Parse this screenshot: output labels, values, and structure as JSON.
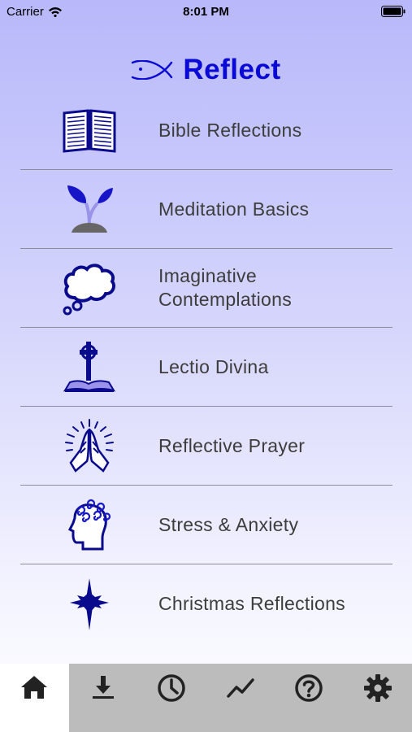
{
  "status_bar": {
    "carrier": "Carrier",
    "time": "8:01 PM"
  },
  "header": {
    "title": "Reflect",
    "logo_icon": "ichthys-fish-icon",
    "accent_color": "#0a0ad6"
  },
  "menu": {
    "items": [
      {
        "label": "Bible Reflections",
        "icon": "open-bible-icon"
      },
      {
        "label": "Meditation Basics",
        "icon": "sprout-icon"
      },
      {
        "label": "Imaginative\nContemplations",
        "icon": "thought-bubble-icon"
      },
      {
        "label": "Lectio Divina",
        "icon": "cross-on-book-icon"
      },
      {
        "label": "Reflective Prayer",
        "icon": "praying-hands-icon"
      },
      {
        "label": "Stress & Anxiety",
        "icon": "head-spirals-icon"
      },
      {
        "label": "Christmas Reflections",
        "icon": "star-icon"
      }
    ]
  },
  "tab_bar": {
    "tabs": [
      {
        "icon": "home-icon",
        "active": true
      },
      {
        "icon": "download-icon",
        "active": false
      },
      {
        "icon": "clock-icon",
        "active": false
      },
      {
        "icon": "trend-icon",
        "active": false
      },
      {
        "icon": "help-icon",
        "active": false
      },
      {
        "icon": "gear-icon",
        "active": false
      }
    ]
  }
}
